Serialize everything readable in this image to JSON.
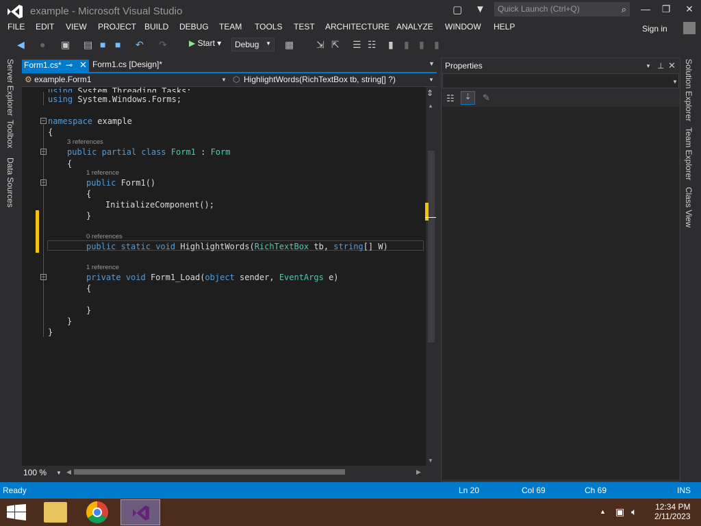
{
  "window": {
    "title": "example - Microsoft Visual Studio"
  },
  "quick_launch": {
    "placeholder": "Quick Launch (Ctrl+Q)"
  },
  "menu": [
    "FILE",
    "EDIT",
    "VIEW",
    "PROJECT",
    "BUILD",
    "DEBUG",
    "TEAM",
    "TOOLS",
    "TEST",
    "ARCHITECTURE",
    "ANALYZE",
    "WINDOW",
    "HELP"
  ],
  "signin": "Sign in",
  "toolbar": {
    "start_label": "Start",
    "config": "Debug"
  },
  "left_rail": [
    "Server Explorer",
    "Toolbox",
    "Data Sources"
  ],
  "right_rail": [
    "Solution Explorer",
    "Team Explorer",
    "Class View"
  ],
  "tabs": [
    {
      "label": "Form1.cs*",
      "active": true
    },
    {
      "label": "Form1.cs [Design]*",
      "active": false
    }
  ],
  "nav": {
    "class": "example.Form1",
    "member": "HighlightWords(RichTextBox tb, string[] ?)"
  },
  "code": {
    "refs": [
      "3 references",
      "1 reference",
      "0 references",
      "1 reference"
    ]
  },
  "zoom": "100 %",
  "properties": {
    "title": "Properties"
  },
  "status": {
    "state": "Ready",
    "ln": "Ln 20",
    "col": "Col 69",
    "ch": "Ch 69",
    "mode": "INS"
  },
  "clock": {
    "time": "12:34 PM",
    "date": "2/11/2023"
  },
  "colors": {
    "accent": "#007acc",
    "editor_bg": "#1e1e1e",
    "chrome": "#2d2d30"
  }
}
